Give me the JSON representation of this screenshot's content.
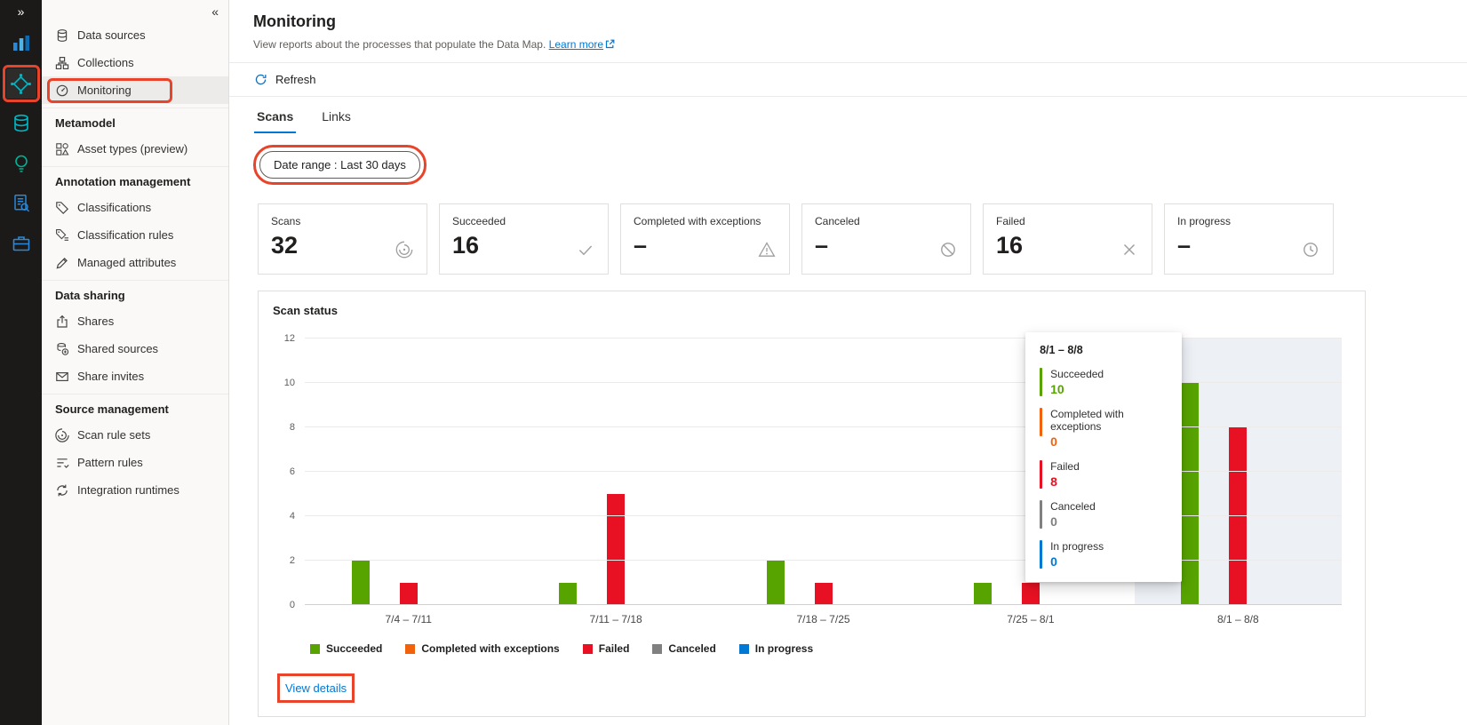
{
  "annotation_color": "#e8442c",
  "rail": {
    "expand_glyph": "»",
    "icons": [
      {
        "name": "reports-icon",
        "selected": false,
        "annotated": false
      },
      {
        "name": "data-map-icon",
        "selected": true,
        "annotated": true
      },
      {
        "name": "data-catalog-icon",
        "selected": false,
        "annotated": false
      },
      {
        "name": "insights-icon",
        "selected": false,
        "annotated": false
      },
      {
        "name": "policy-icon",
        "selected": false,
        "annotated": false
      },
      {
        "name": "management-icon",
        "selected": false,
        "annotated": false
      }
    ]
  },
  "sidebar": {
    "collapse_glyph": "«",
    "items": [
      {
        "type": "item",
        "label": "Data sources",
        "icon": "database-icon"
      },
      {
        "type": "item",
        "label": "Collections",
        "icon": "collections-icon"
      },
      {
        "type": "item",
        "label": "Monitoring",
        "icon": "monitoring-icon",
        "selected": true,
        "annotated": true
      },
      {
        "type": "header",
        "label": "Metamodel"
      },
      {
        "type": "item",
        "label": "Asset types (preview)",
        "icon": "asset-types-icon"
      },
      {
        "type": "header",
        "label": "Annotation management"
      },
      {
        "type": "item",
        "label": "Classifications",
        "icon": "classifications-icon"
      },
      {
        "type": "item",
        "label": "Classification rules",
        "icon": "classification-rules-icon"
      },
      {
        "type": "item",
        "label": "Managed attributes",
        "icon": "managed-attributes-icon"
      },
      {
        "type": "header",
        "label": "Data sharing"
      },
      {
        "type": "item",
        "label": "Shares",
        "icon": "shares-icon"
      },
      {
        "type": "item",
        "label": "Shared sources",
        "icon": "shared-sources-icon"
      },
      {
        "type": "item",
        "label": "Share invites",
        "icon": "share-invites-icon"
      },
      {
        "type": "header",
        "label": "Source management"
      },
      {
        "type": "item",
        "label": "Scan rule sets",
        "icon": "scan-rules-icon"
      },
      {
        "type": "item",
        "label": "Pattern rules",
        "icon": "pattern-rules-icon"
      },
      {
        "type": "item",
        "label": "Integration runtimes",
        "icon": "integration-runtimes-icon"
      }
    ]
  },
  "header": {
    "title": "Monitoring",
    "subtitle": "View reports about the processes that populate the Data Map.",
    "learn_more_label": "Learn more",
    "refresh_label": "Refresh"
  },
  "tabs": [
    {
      "label": "Scans",
      "active": true
    },
    {
      "label": "Links",
      "active": false
    }
  ],
  "filters": {
    "date_range_label": "Date range : Last 30 days"
  },
  "stats": [
    {
      "label": "Scans",
      "value": "32",
      "icon": "scan-icon"
    },
    {
      "label": "Succeeded",
      "value": "16",
      "icon": "check-icon"
    },
    {
      "label": "Completed with exceptions",
      "value": "–",
      "icon": "warning-icon"
    },
    {
      "label": "Canceled",
      "value": "–",
      "icon": "blocked-icon"
    },
    {
      "label": "Failed",
      "value": "16",
      "icon": "x-icon"
    },
    {
      "label": "In progress",
      "value": "–",
      "icon": "progress-icon"
    }
  ],
  "chart_data": {
    "type": "bar",
    "title": "Scan status",
    "categories": [
      "7/4 – 7/11",
      "7/11 – 7/18",
      "7/18 – 7/25",
      "7/25 – 8/1",
      "8/1 – 8/8"
    ],
    "series": [
      {
        "name": "Succeeded",
        "color": "#57a300",
        "values": [
          2,
          1,
          2,
          1,
          10
        ]
      },
      {
        "name": "Completed with exceptions",
        "color": "#f2610c",
        "values": [
          0,
          0,
          0,
          0,
          0
        ]
      },
      {
        "name": "Failed",
        "color": "#e81123",
        "values": [
          1,
          5,
          1,
          1,
          8
        ]
      },
      {
        "name": "Canceled",
        "color": "#808080",
        "values": [
          0,
          0,
          0,
          0,
          0
        ]
      },
      {
        "name": "In progress",
        "color": "#0078d4",
        "values": [
          0,
          0,
          0,
          0,
          0
        ]
      }
    ],
    "ylim": [
      0,
      12
    ],
    "yticks": [
      0,
      2,
      4,
      6,
      8,
      10,
      12
    ],
    "grid": true,
    "legend_position": "bottom",
    "highlighted_category_index": 4
  },
  "tooltip": {
    "title": "8/1 – 8/8",
    "entries": [
      {
        "label": "Succeeded",
        "value": "10",
        "color": "#57a300"
      },
      {
        "label": "Completed with exceptions",
        "value": "0",
        "color": "#f2610c"
      },
      {
        "label": "Failed",
        "value": "8",
        "color": "#e81123"
      },
      {
        "label": "Canceled",
        "value": "0",
        "color": "#808080"
      },
      {
        "label": "In progress",
        "value": "0",
        "color": "#0078d4"
      }
    ]
  },
  "footer": {
    "view_details_label": "View details"
  }
}
